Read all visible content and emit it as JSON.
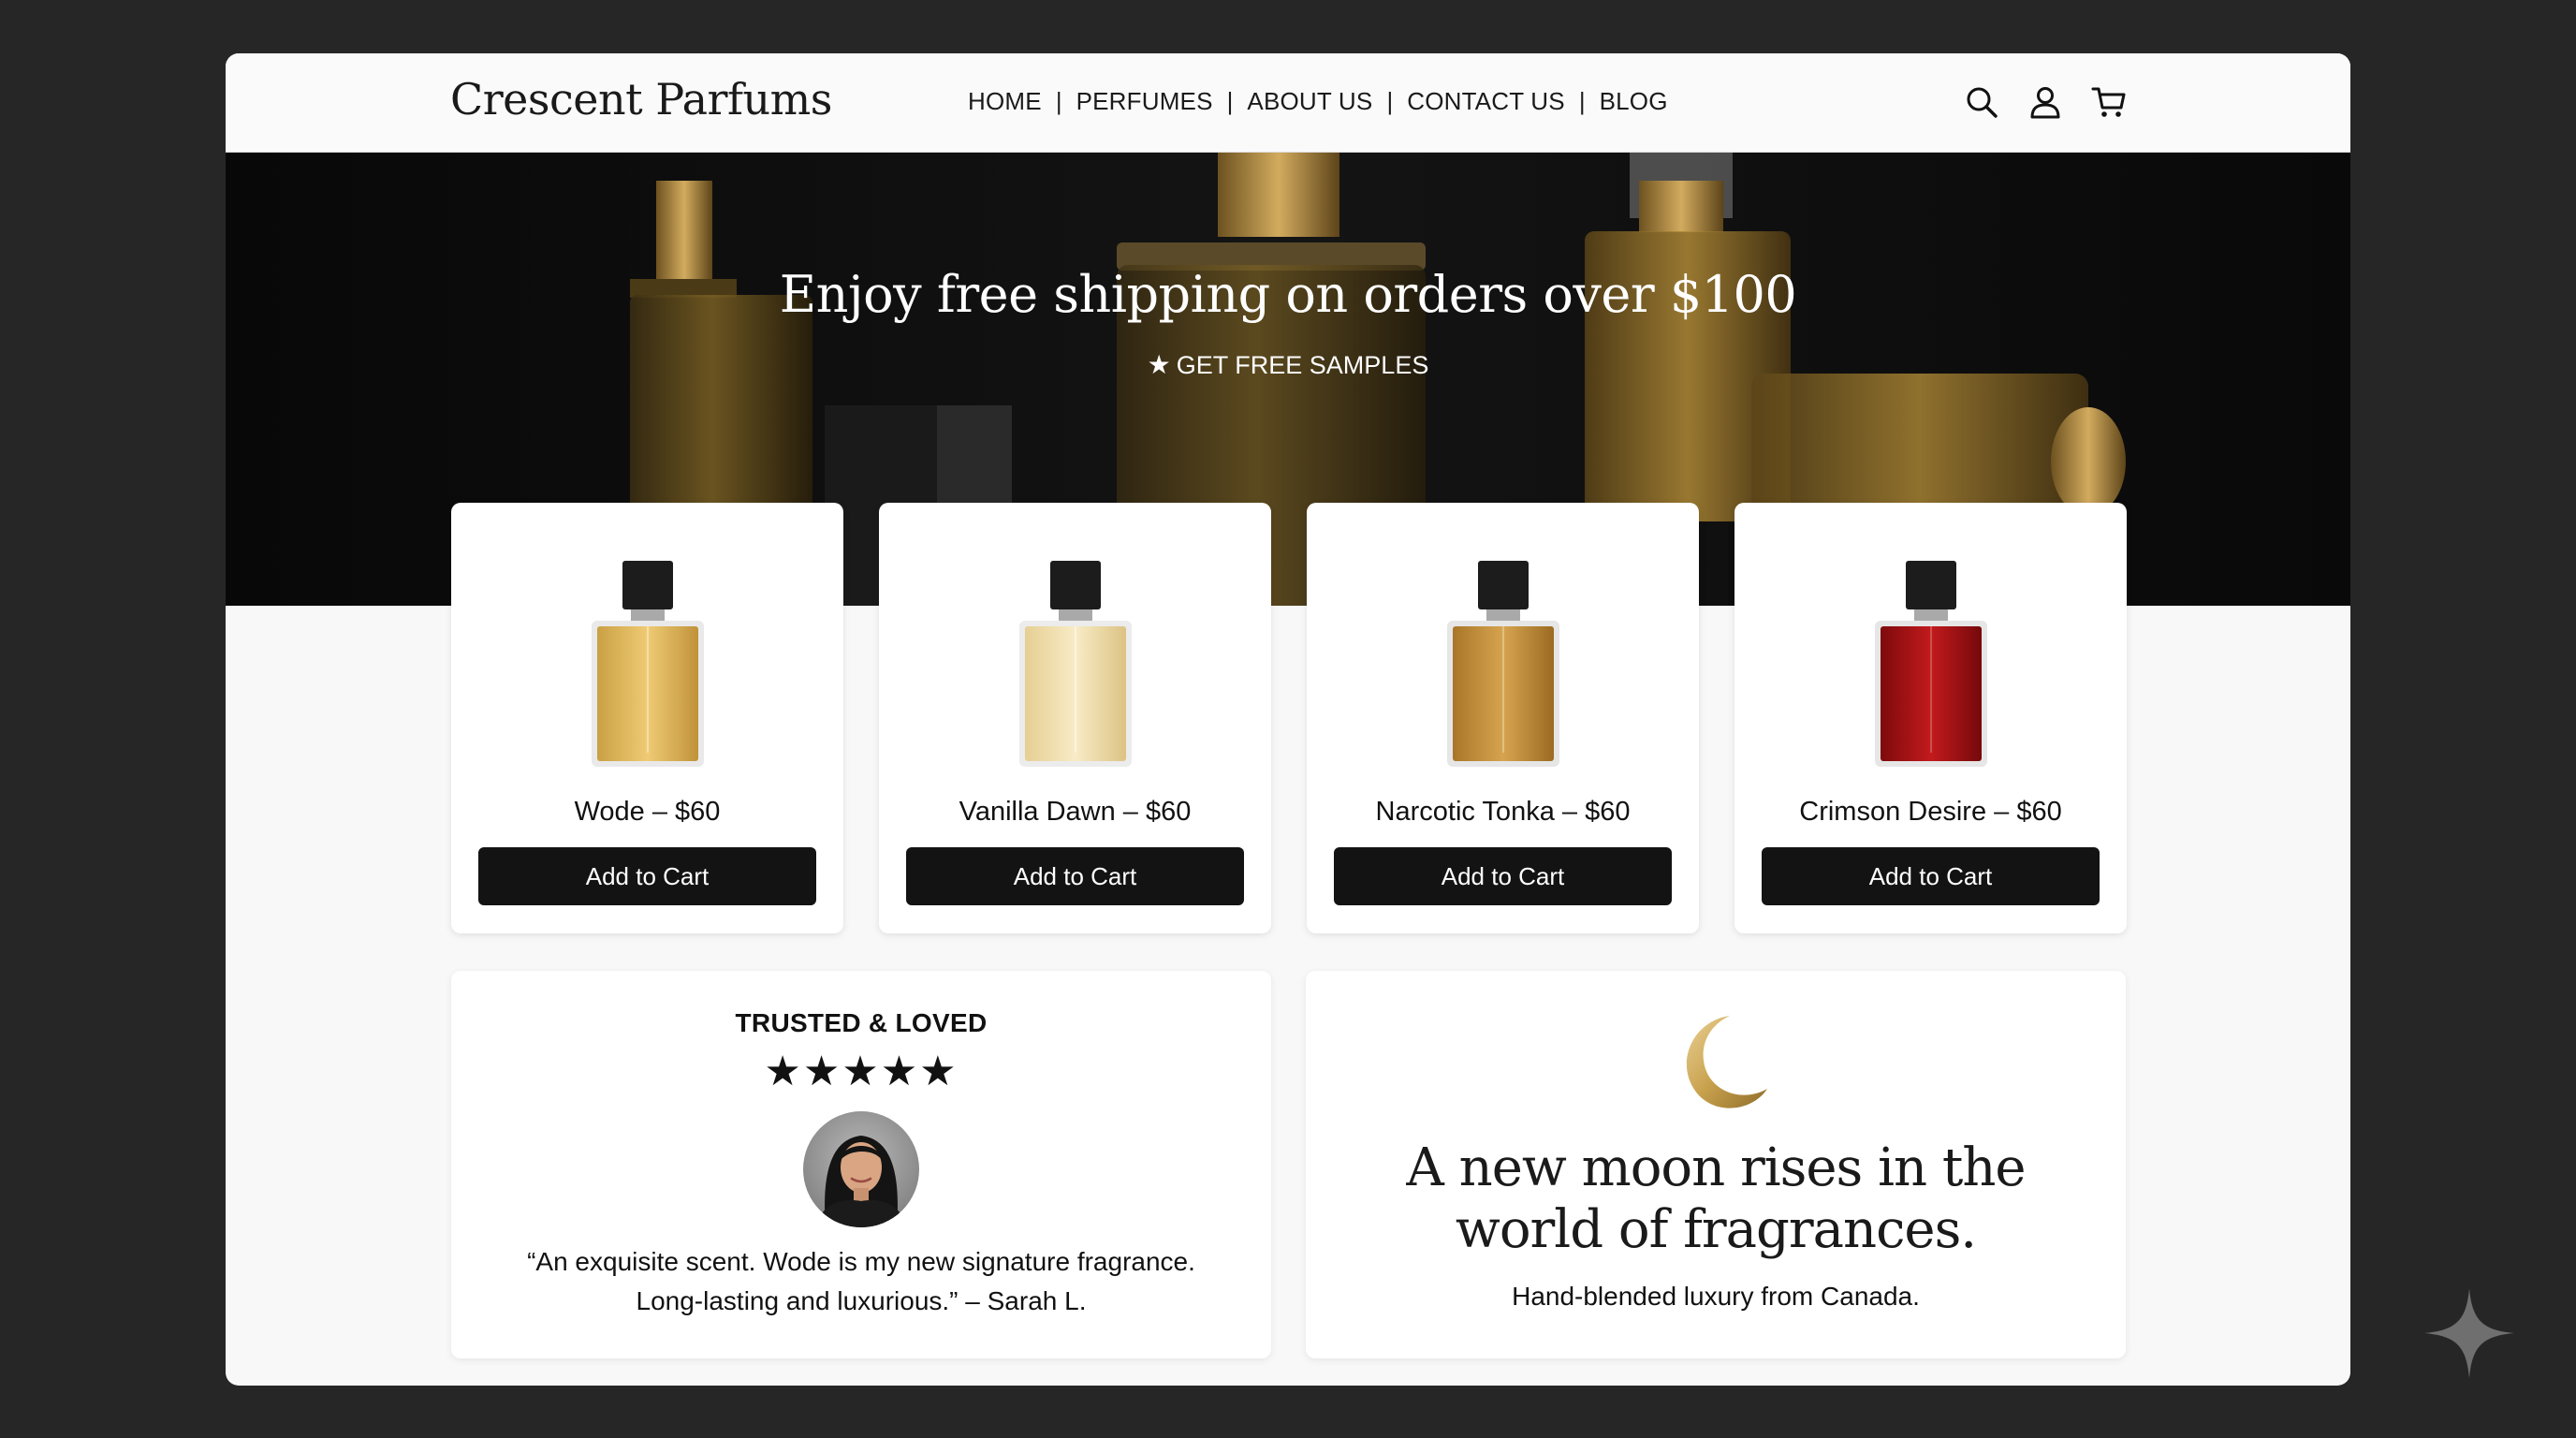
{
  "header": {
    "brand": "Crescent Parfums",
    "nav": [
      "HOME",
      "PERFUMES",
      "ABOUT US",
      "CONTACT US",
      "BLOG"
    ],
    "separator": "|",
    "icons": [
      "search-icon",
      "user-icon",
      "cart-icon"
    ]
  },
  "hero": {
    "title": "Enjoy free shipping on orders over $100",
    "star_glyph": "★",
    "subtitle": "GET FREE SAMPLES"
  },
  "products": [
    {
      "name": "Wode – $60",
      "button": "Add to Cart",
      "liquid_color": "#e3b450"
    },
    {
      "name": "Vanilla Dawn – $60",
      "button": "Add to Cart",
      "liquid_color": "#f1deac"
    },
    {
      "name": "Narcotic Tonka – $60",
      "button": "Add to Cart",
      "liquid_color": "#c48f3c"
    },
    {
      "name": "Crimson Desire – $60",
      "button": "Add to Cart",
      "liquid_color": "#a80f12"
    }
  ],
  "testimonial": {
    "heading": "TRUSTED & LOVED",
    "stars": "★★★★★",
    "rating": 5,
    "quote": "“An exquisite scent. Wode is my new signature fragrance. Long-lasting and luxurious.” – Sarah L."
  },
  "brand_panel": {
    "icon": "crescent-moon-icon",
    "tagline_line1": "A new moon rises in the",
    "tagline_line2": "world of fragrances.",
    "subtext": "Hand-blended luxury from Canada."
  },
  "colors": {
    "page_bg": "#262626",
    "button_bg": "#131313",
    "gold_accent": "#c9a24e"
  }
}
